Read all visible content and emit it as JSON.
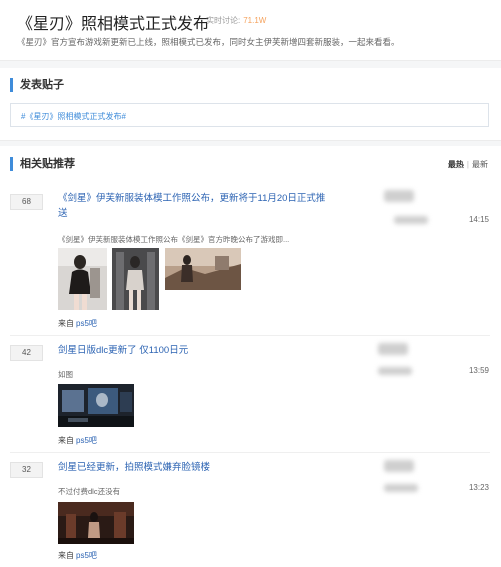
{
  "header": {
    "title": "《星刃》照相模式正式发布",
    "realtime_label": "实时讨论:",
    "realtime_count": "71.1W",
    "description": "《星刃》官方宣布游戏新更新已上线，照相模式已发布，同时女主伊芙新增四套新服装，一起来看看。"
  },
  "post_section": {
    "heading": "发表贴子",
    "topic_tag": "#《星刃》照相模式正式发布#"
  },
  "related_section": {
    "heading": "相关贴推荐",
    "sort_hot": "最热",
    "sort_divider": "|",
    "sort_new": "最新"
  },
  "posts": [
    {
      "replies": "68",
      "title": "《剑星》伊芙新服装体模工作照公布，更新将于11月20日正式推送",
      "abstract": "《剑星》伊芙新服装体模工作照公布《剑星》官方昨晚公布了游戏即...",
      "from_label": "来自",
      "forum": "ps5吧",
      "time": "14:15"
    },
    {
      "replies": "42",
      "title": "剑星日版dlc更新了 仅1100日元",
      "abstract": "如图",
      "from_label": "来自",
      "forum": "ps5吧",
      "time": "13:59"
    },
    {
      "replies": "32",
      "title": "剑星已经更新，拍照模式嫌弃脸镜楼",
      "abstract": "不过付费dlc还没有",
      "from_label": "来自",
      "forum": "ps5吧",
      "time": "13:23"
    }
  ]
}
